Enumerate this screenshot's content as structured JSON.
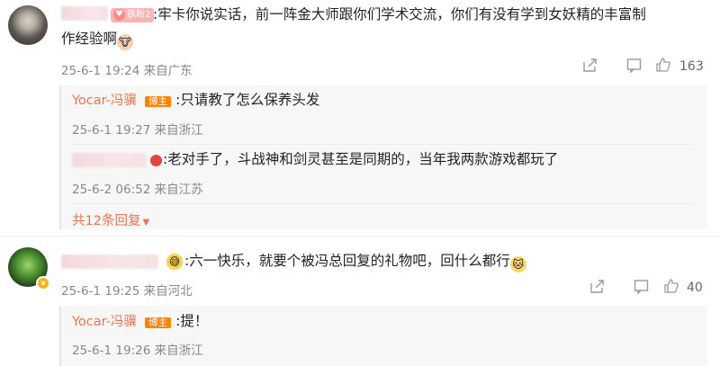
{
  "comments": [
    {
      "text_part1": ":牢卡你说实话，前一阵金大师跟你们学术交流，你们有没有学到女妖精的丰富制",
      "text_part2": "作经验啊",
      "fan_badge": "铁粉2",
      "time": "25-6-1 19:24",
      "location": "来自广东",
      "likes": "163",
      "replies": [
        {
          "name": "Yocar-冯骥",
          "badge": "博主",
          "text": ":只请教了怎么保养头发",
          "time": "25-6-1 19:27",
          "location": "来自浙江"
        },
        {
          "name": "",
          "badge": "",
          "text": ":老对手了，斗战神和剑灵甚至是同期的，当年我两款游戏都玩了",
          "time": "25-6-2 06:52",
          "location": "来自江苏"
        }
      ],
      "more_replies": "共12条回复"
    },
    {
      "text": ":六一快乐，就要个被冯总回复的礼物吧，回什么都行",
      "time": "25-6-1 19:25",
      "location": "来自河北",
      "likes": "40",
      "replies": [
        {
          "name": "Yocar-冯骥",
          "badge": "博主",
          "text": ":提！",
          "time": "25-6-1 19:26",
          "location": "来自浙江"
        }
      ]
    }
  ],
  "icons": {
    "share": "share-icon",
    "comment": "comment-icon",
    "like": "thumbs-up-icon",
    "more_arrow": "caret-down-icon"
  },
  "colors": {
    "accent": "#eb7350",
    "host_badge": "#ff8200",
    "meta": "#888888"
  }
}
